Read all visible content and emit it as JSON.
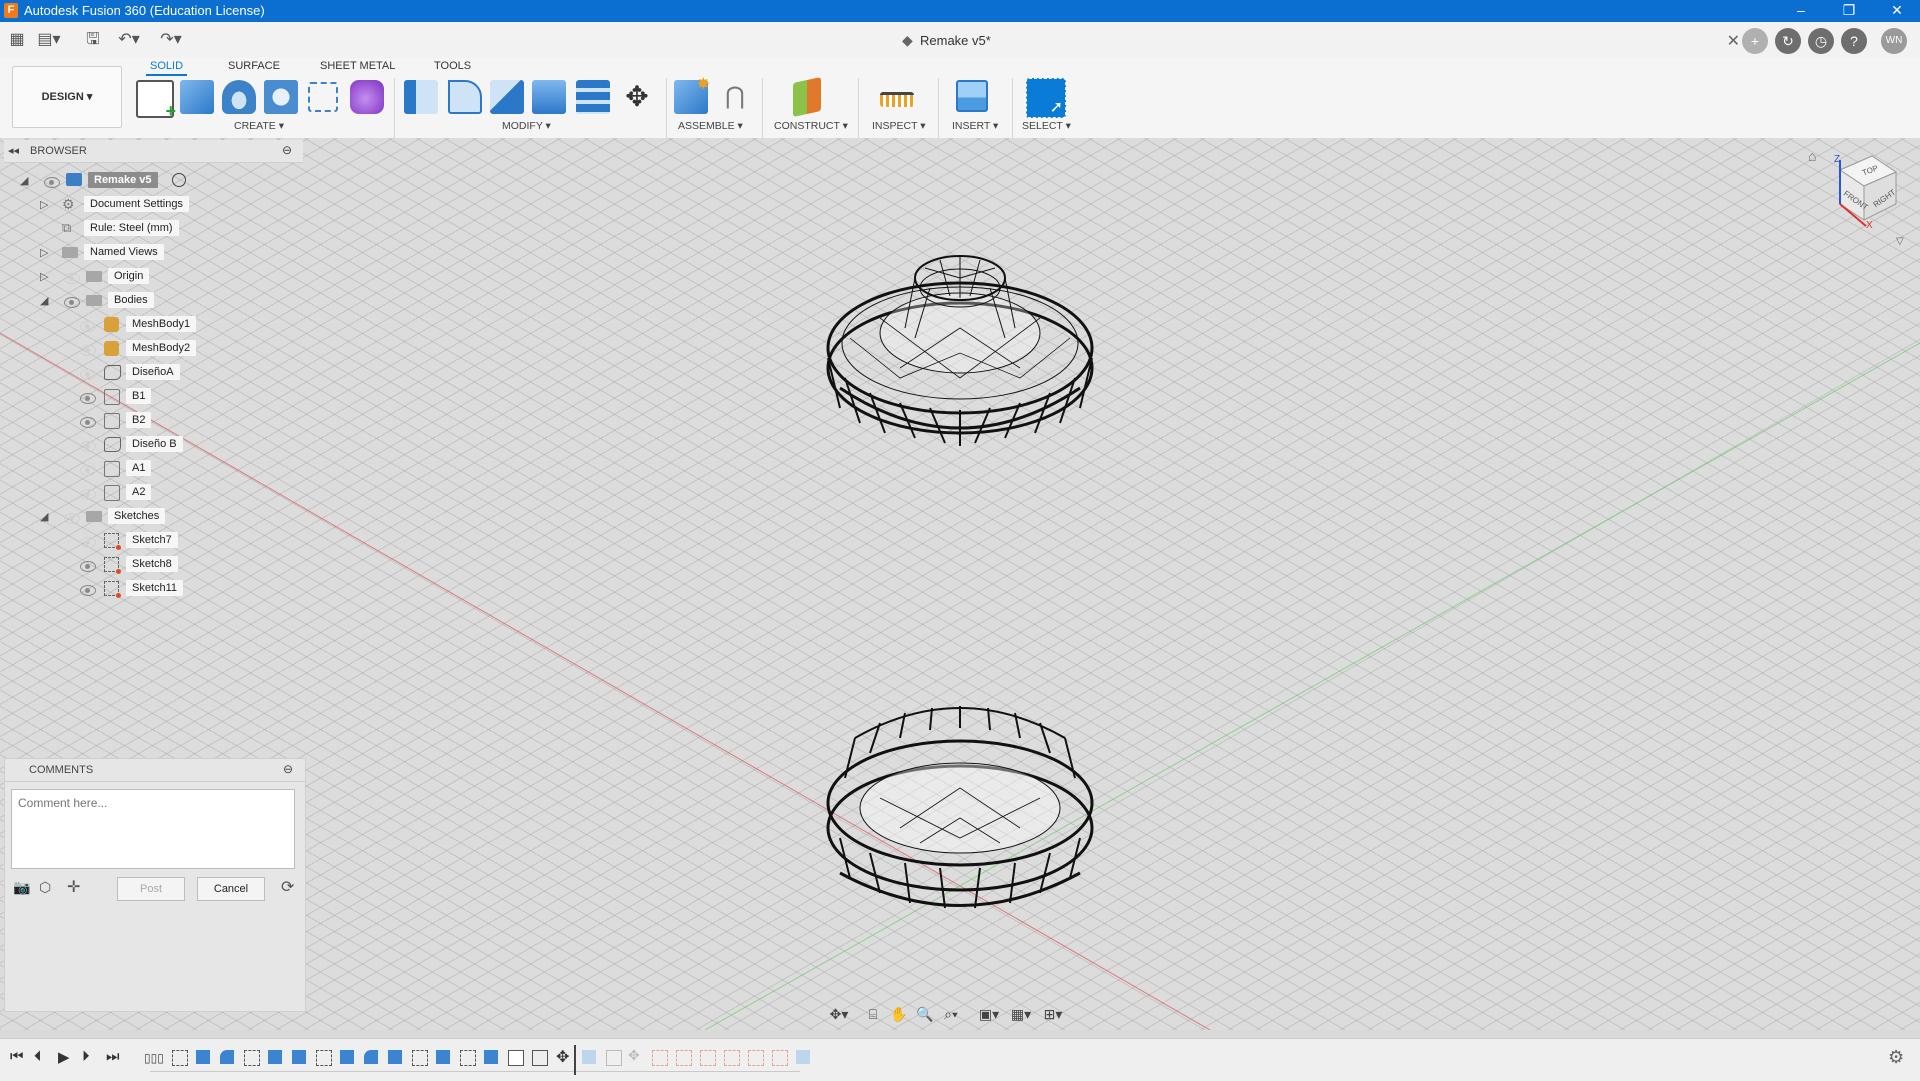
{
  "window": {
    "title": "Autodesk Fusion 360 (Education License)",
    "app_icon": "F",
    "controls": [
      "–",
      "❐",
      "✕"
    ]
  },
  "document_tab": {
    "name": "Remake v5*",
    "close": "✕"
  },
  "user_initials": "WN",
  "ribbon": {
    "workspace": "DESIGN ▾",
    "tabs": [
      {
        "label": "SOLID",
        "active": true
      },
      {
        "label": "SURFACE",
        "active": false
      },
      {
        "label": "SHEET METAL",
        "active": false
      },
      {
        "label": "TOOLS",
        "active": false
      }
    ],
    "groups": [
      "CREATE ▾",
      "MODIFY ▾",
      "ASSEMBLE ▾",
      "CONSTRUCT ▾",
      "INSPECT ▾",
      "INSERT ▾",
      "SELECT ▾"
    ]
  },
  "browser": {
    "title": "BROWSER",
    "root": "Remake v5",
    "items": [
      {
        "label": "Document Settings"
      },
      {
        "label": "Rule: Steel (mm)"
      },
      {
        "label": "Named Views"
      },
      {
        "label": "Origin"
      },
      {
        "label": "Bodies"
      },
      {
        "label": "MeshBody1"
      },
      {
        "label": "MeshBody2"
      },
      {
        "label": "DiseñoA"
      },
      {
        "label": "B1"
      },
      {
        "label": "B2"
      },
      {
        "label": "Diseño B"
      },
      {
        "label": "A1"
      },
      {
        "label": "A2"
      },
      {
        "label": "Sketches"
      },
      {
        "label": "Sketch7"
      },
      {
        "label": "Sketch8"
      },
      {
        "label": "Sketch11"
      }
    ]
  },
  "comments": {
    "title": "COMMENTS",
    "placeholder": "Comment here...",
    "post": "Post",
    "cancel": "Cancel"
  },
  "viewcube": {
    "top": "TOP",
    "front": "FRONT",
    "right": "RIGHT",
    "axis_x": "X",
    "axis_z": "Z"
  },
  "colors": {
    "titlebar": "#0a6fd1",
    "accent": "#0a78d6",
    "x_axis": "#e05050",
    "y_axis": "#50c050",
    "z_axis": "#3050e0"
  }
}
